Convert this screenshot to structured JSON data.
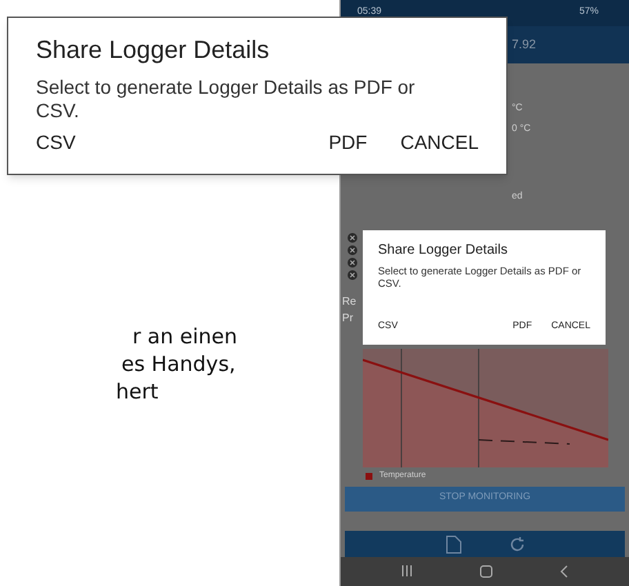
{
  "document_text": [
    "r an einen",
    "es Handys,",
    "hert"
  ],
  "callout_dialog": {
    "title": "Share Logger Details",
    "message": "Select to generate Logger Details as PDF or CSV.",
    "buttons": [
      "CSV",
      "PDF",
      "CANCEL"
    ]
  },
  "phone": {
    "status_bar": {
      "time": "05:39",
      "battery": "57%"
    },
    "header": {
      "value": "7.92"
    },
    "readings": [
      "°C",
      "0 °C"
    ],
    "status_text": "ed",
    "side_labels": [
      "Re",
      "Pr"
    ],
    "dialog": {
      "title": "Share Logger Details",
      "message": "Select to generate Logger Details as PDF or CSV.",
      "buttons": [
        "CSV",
        "PDF",
        "CANCEL"
      ]
    },
    "chart": {
      "legend": "Temperature"
    },
    "stop_button": "STOP MONITORING"
  }
}
